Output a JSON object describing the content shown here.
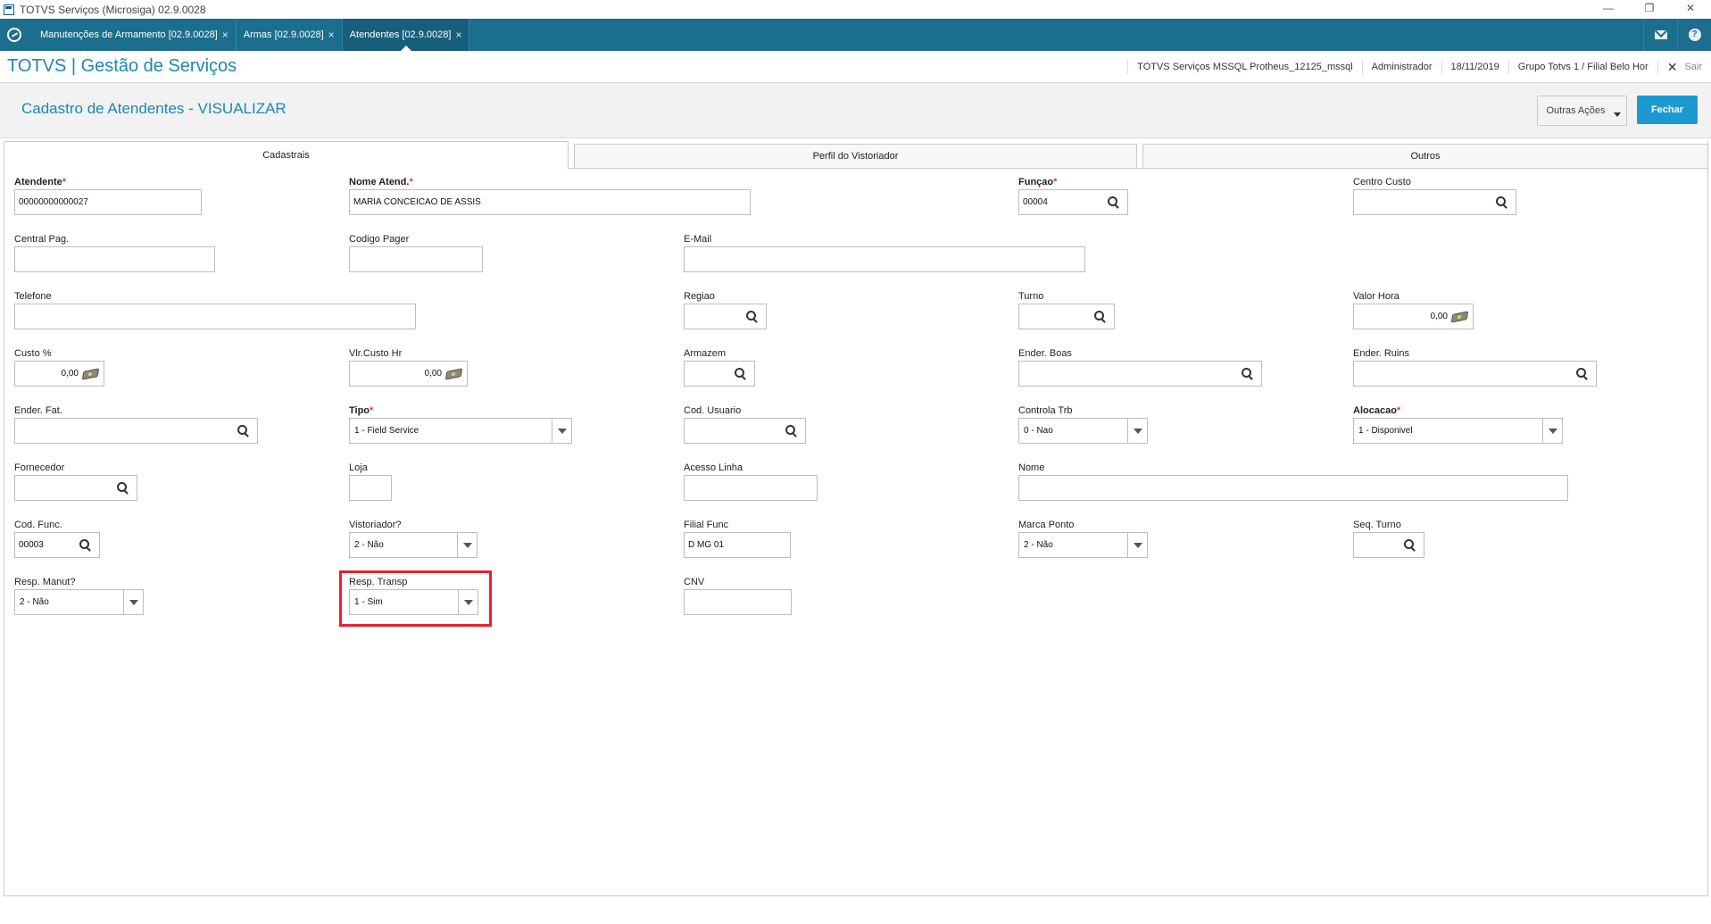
{
  "window": {
    "title": "TOTVS Serviços (Microsiga) 02.9.0028",
    "controls": [
      "—",
      "❐",
      "✕"
    ]
  },
  "tabs": [
    {
      "label": "Manutenções de Armamento [02.9.0028]",
      "close": "×"
    },
    {
      "label": "Armas [02.9.0028]",
      "close": "×"
    },
    {
      "label": "Atendentes [02.9.0028]",
      "close": "×"
    }
  ],
  "header": {
    "brand": "TOTVS | Gestão de Serviços",
    "environment": "TOTVS Serviços MSSQL Protheus_12125_mssql",
    "user": "Administrador",
    "date": "18/11/2019",
    "branch": "Grupo Totvs 1 / Filial Belo Hor",
    "logout": "Sair"
  },
  "page": {
    "title": "Cadastro de Atendentes - VISUALIZAR",
    "other_actions": "Outras Ações",
    "close": "Fechar"
  },
  "folder_tabs": [
    "Cadastrais",
    "Perfil do Vistoriador",
    "Outros"
  ],
  "fields": {
    "atendente": {
      "label": "Atendente",
      "value": "00000000000027"
    },
    "nome_atend": {
      "label": "Nome Atend.",
      "value": "MARIA CONCEICAO DE ASSIS"
    },
    "funcao": {
      "label": "Funçao",
      "value": "00004"
    },
    "centro_custo": {
      "label": "Centro Custo",
      "value": ""
    },
    "central_pag": {
      "label": "Central Pag.",
      "value": ""
    },
    "codigo_pager": {
      "label": "Codigo Pager",
      "value": ""
    },
    "email": {
      "label": "E-Mail",
      "value": ""
    },
    "telefone": {
      "label": "Telefone",
      "value": ""
    },
    "regiao": {
      "label": "Regiao",
      "value": ""
    },
    "turno": {
      "label": "Turno",
      "value": ""
    },
    "valor_hora": {
      "label": "Valor Hora",
      "value": "0,00"
    },
    "custo_pct": {
      "label": "Custo  %",
      "value": "0,00"
    },
    "vlr_custo_hr": {
      "label": "Vlr.Custo Hr",
      "value": "0,00"
    },
    "armazem": {
      "label": "Armazem",
      "value": ""
    },
    "ender_boas": {
      "label": "Ender. Boas",
      "value": ""
    },
    "ender_ruins": {
      "label": "Ender. Ruins",
      "value": ""
    },
    "ender_fat": {
      "label": "Ender.  Fat.",
      "value": ""
    },
    "tipo": {
      "label": "Tipo",
      "value": "1 - Field Service"
    },
    "cod_usuario": {
      "label": "Cod. Usuario",
      "value": ""
    },
    "controla_trb": {
      "label": "Controla Trb",
      "value": "0 - Nao"
    },
    "alocacao": {
      "label": "Alocacao",
      "value": "1 - Disponivel"
    },
    "fornecedor": {
      "label": "Fornecedor",
      "value": ""
    },
    "loja": {
      "label": "Loja",
      "value": ""
    },
    "acesso_linha": {
      "label": "Acesso Linha",
      "value": ""
    },
    "nome": {
      "label": "Nome",
      "value": ""
    },
    "cod_func": {
      "label": "Cod. Func.",
      "value": "00003"
    },
    "vistoriador": {
      "label": "Vistoriador?",
      "value": "2 - Não"
    },
    "filial_func": {
      "label": "Filial Func",
      "value": "D MG 01"
    },
    "marca_ponto": {
      "label": "Marca Ponto",
      "value": "2 - Não"
    },
    "seq_turno": {
      "label": "Seq. Turno",
      "value": ""
    },
    "resp_manut": {
      "label": "Resp. Manut?",
      "value": "2 - Não"
    },
    "resp_transp": {
      "label": "Resp. Transp",
      "value": "1 - Sim"
    },
    "cnv": {
      "label": "CNV",
      "value": ""
    }
  },
  "required_marker": "*",
  "colors": {
    "accent": "#1a87b8",
    "tabbar": "#1b6e8e",
    "primary_button": "#1b9ad1",
    "highlight": "#e8202a",
    "required": "#e03b3b"
  }
}
